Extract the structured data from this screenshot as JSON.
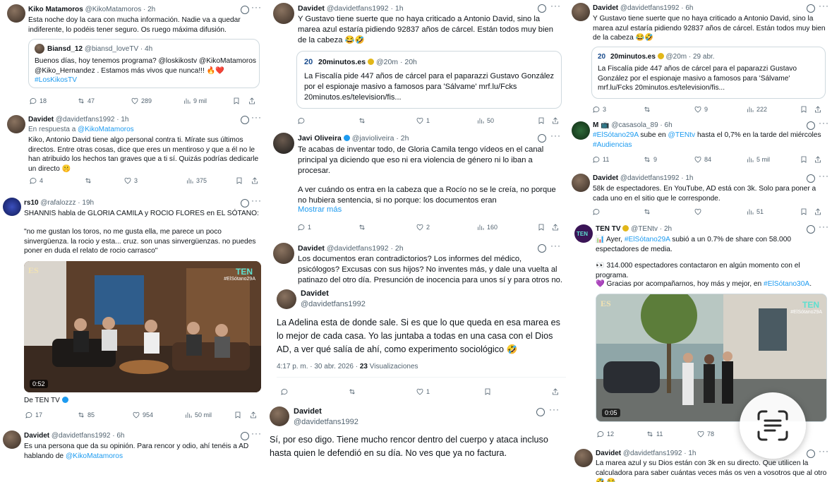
{
  "col1": {
    "t1": {
      "name": "Kiko Matamoros",
      "handle": "@KikoMatamoros",
      "time": "· 2h",
      "text": "Esta noche doy la cara con mucha información. Nadie va a quedar indiferente, lo podéis tener seguro. Os ruego máxima difusión.",
      "quote_name": "Biansd_12",
      "quote_handle": "@biansd_loveTV · 4h",
      "quote_text1": "Buenos días, hoy tenemos programa? @loskikostv @KikoMatamoros",
      "quote_text2": "@Kiko_Hernandez . Estamos más vivos que nunca!!! 🔥❤️",
      "quote_text3": "#LosKikosTV",
      "replies": "18",
      "retweets": "47",
      "likes": "289",
      "views": "9 mil"
    },
    "t2": {
      "name": "Davidet",
      "handle": "@davidetfans1992 · 1h",
      "reply_prefix": "En respuesta a",
      "reply_to": "@KikoMatamoros",
      "text": "Kiko, Antonio David tiene algo personal contra ti. Mírate sus últimos directos. Entre otras cosas, dice que eres un mentiroso y que a él no le han atribuido los hechos tan graves que a ti sí. Quizás podrías dedicarle un directo 🤫",
      "replies": "4",
      "likes": "3",
      "views": "375"
    },
    "t3": {
      "name": "rs10",
      "handle": "@rafalozzz · 19h",
      "text": "SHANNIS habla de GLORIA CAMILA y ROCIO FLORES en EL SÓTANO:",
      "quote": "\"no me gustan los toros, no me gusta ella, me parece un poco sinvergüenza. la rocio y esta... cruz. son unas sinvergüenzas. no puedes poner en duda el relato de rocio carrasco\"",
      "video_time": "0:52",
      "source": "De TEN TV",
      "logo_ten": "TEN",
      "logo_es": "ES",
      "tag": "#ElSótano29A",
      "replies": "17",
      "retweets": "85",
      "likes": "954",
      "views": "50 mil"
    },
    "t4": {
      "name": "Davidet",
      "handle": "@davidetfans1992 · 6h",
      "text": "Es una persona que da su opinión. Para rencor y odio, ahí tenéis a AD hablando de",
      "mention": "@KikoMatamoros"
    }
  },
  "col2": {
    "t1": {
      "name": "Davidet",
      "handle": "@davidetfans1992 · 1h",
      "text": "Y Gustavo tiene suerte que no haya criticado a Antonio David, sino la marea azul estaría pidiendo 92837 años de cárcel. Están todos muy bien de la cabeza 😂🤣",
      "q_logo": "20",
      "q_name": "20minutos.es",
      "q_handle": "@20m · 20h",
      "q_text": "La Fiscalía pide 447 años de cárcel para el paparazzi Gustavo González por el espionaje masivo a famosos para 'Sálvame' mrf.lu/Fcks 20minutos.es/television/fis...",
      "likes": "1",
      "views": "50"
    },
    "t2": {
      "name": "Javi Oliveira",
      "handle": "@javioliveira · 2h",
      "text1": "Te acabas de inventar todo, de Gloria Camila tengo vídeos en el canal principal ya diciendo que eso ni era violencia de género ni lo iban a procesar.",
      "text2": "A ver cuándo os entra en la cabeza que a Rocío no se le creía, no porque no hubiera sentencia, si no porque: los documentos eran",
      "show_more": "Mostrar más",
      "replies": "1",
      "likes": "2",
      "views": "160"
    },
    "t3": {
      "name": "Davidet",
      "handle": "@davidetfans1992 · 2h",
      "text": "Los documentos eran contradictorios? Los informes del médico, psicólogos? Excusas con sus hijos? No inventes más, y dale una vuelta al patinazo del otro día. Presunción de inocencia para unos sí y para otros no."
    },
    "t4": {
      "name": "Davidet",
      "handle": "@davidetfans1992",
      "text": "La Adelina esta de donde sale. Si es que lo que queda en esa marea es lo mejor de cada casa.  Yo las juntaba a todas en una casa con el Dios AD, a ver qué salía de ahí, como experimento sociológico 🤣",
      "meta_time": "4:17 p. m. · 30 abr. 2026 · ",
      "meta_views_num": "23",
      "meta_views_label": " Visualizaciones",
      "likes": "1"
    },
    "t5": {
      "name": "Davidet",
      "handle": "@davidetfans1992",
      "text": "Sí, por eso digo. Tiene mucho rencor dentro del cuerpo y ataca incluso hasta quien le defendió en su día. No ves que ya no factura."
    }
  },
  "col3": {
    "t1": {
      "name": "Davidet",
      "handle": "@davidetfans1992 · 6h",
      "text": "Y Gustavo tiene suerte que no haya criticado a Antonio David, sino la marea azul estaría pidiendo 92837 años de cárcel. Están todos muy bien de la cabeza 😂🤣",
      "q_logo": "20",
      "q_name": "20minutos.es",
      "q_handle": "@20m · 29 abr.",
      "q_text": "La Fiscalía pide 447 años de cárcel para el paparazzi Gustavo González por el espionaje masivo a famosos para 'Sálvame' mrf.lu/Fcks 20minutos.es/television/fis...",
      "replies": "3",
      "likes": "9",
      "views": "222"
    },
    "t2": {
      "name": "M 📺",
      "handle": "@casasola_89 · 6h",
      "tag1": "#ElSótano29A",
      "mid1": " sube en ",
      "tag2": "@TENtv",
      "mid2": " hasta el 0,7% en la tarde del miércoles ",
      "tag3": "#Audiencias",
      "replies": "11",
      "retweets": "9",
      "likes": "84",
      "views": "5 mil"
    },
    "t3": {
      "name": "Davidet",
      "handle": "@davidetfans1992 · 1h",
      "text": "58k de espectadores. En YouTube, AD está con 3k. Solo para poner a cada uno en el sitio que le corresponde.",
      "views": "51"
    },
    "t4": {
      "name": "TEN TV",
      "handle": "@TENtv · 2h",
      "av": "TEN",
      "l1a": "📊 Ayer, ",
      "l1tag": "#ElSótano29A",
      "l1b": " subió a un 0.7% de share con 58.000 espectadores de media.",
      "l2": "👀 314.000 espectadores contactaron en algún momento con el programa.",
      "l3a": "💜 Gracias por acompañarnos, hoy más y mejor, en ",
      "l3tag": "#ElSótano30A",
      "l3b": ".",
      "video_time": "0:05",
      "logo_ten": "TEN",
      "logo_es": "ES",
      "tag": "#ElSótano29A",
      "replies": "12",
      "retweets": "11",
      "likes": "78"
    },
    "t5": {
      "name": "Davidet",
      "handle": "@davidetfans1992 · 1h",
      "text": "La marea azul y su Dios están con 3k en su directo. Que utilicen la calculadora para saber cuántas veces más os ven a vosotros que al otro 🤣 😂"
    }
  },
  "colors": {
    "accent": "#1d9bf0",
    "text": "#0f1419",
    "muted": "#536471",
    "border": "#cfd9de",
    "ten_purple": "#6b2fa0"
  }
}
